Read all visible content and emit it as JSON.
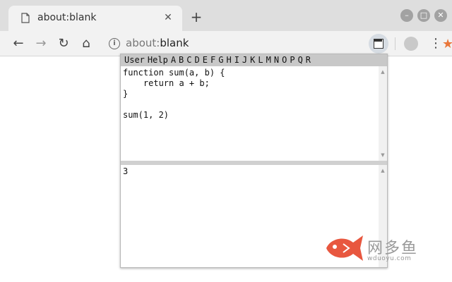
{
  "browser": {
    "tab_title": "about:blank",
    "tab_close_glyph": "✕",
    "new_tab_glyph": "+",
    "url_scheme": "about:",
    "url_host": "blank",
    "icons": {
      "back": "←",
      "forward": "→",
      "reload": "↻",
      "home": "⌂",
      "info": "i",
      "star": "★",
      "menu": "⋮",
      "minimize": "–",
      "maximize": "□",
      "close": "✕"
    },
    "star_color": "#e9773a"
  },
  "popup": {
    "menu_items": [
      "User",
      "Help",
      "A",
      "B",
      "C",
      "D",
      "E",
      "F",
      "G",
      "H",
      "I",
      "J",
      "K",
      "L",
      "M",
      "N",
      "O",
      "P",
      "Q",
      "R"
    ],
    "code": "function sum(a, b) {\n    return a + b;\n}\n\nsum(1, 2)",
    "output": "3",
    "scroll_up_glyph": "▲",
    "scroll_down_glyph": "▼"
  },
  "watermark": {
    "name": "网多鱼",
    "site": "wduoyu.com",
    "fish_color": "#e8573f"
  }
}
